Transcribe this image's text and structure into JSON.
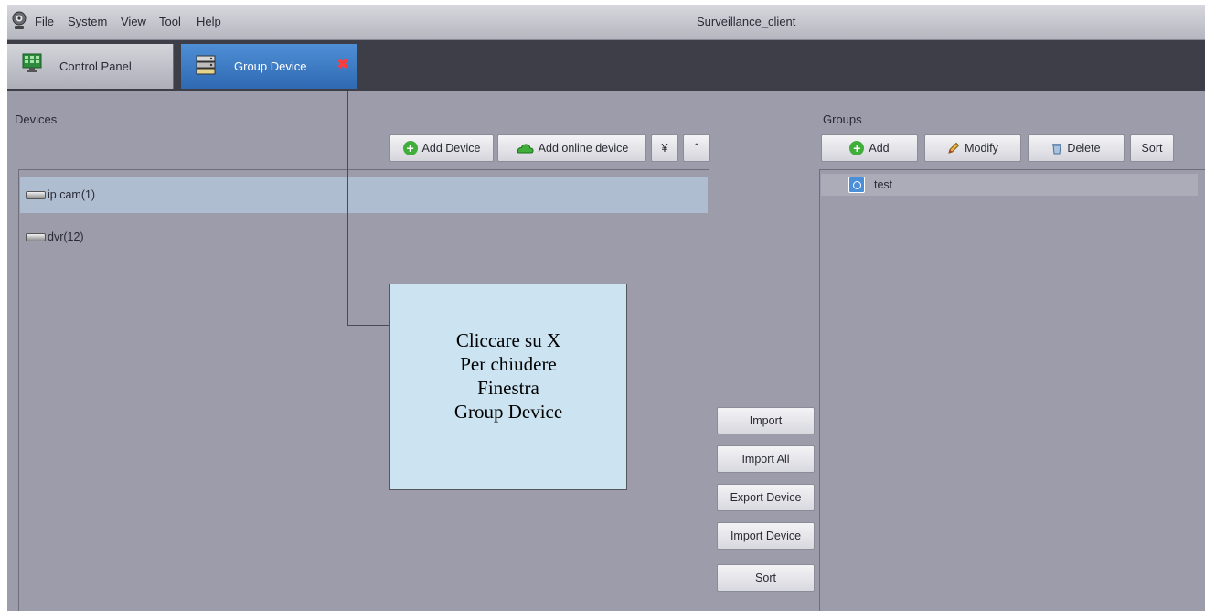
{
  "menubar": {
    "logo_icon": "webcam-icon",
    "items": [
      "File",
      "System",
      "View",
      "Tool",
      "Help"
    ],
    "window_title": "Surveillance_client"
  },
  "tabs": [
    {
      "label": "Control Panel",
      "icon": "monitor-grid-icon",
      "active": false
    },
    {
      "label": "Group Device",
      "icon": "device-stack-icon",
      "active": true,
      "close_icon": "close-icon",
      "close_symbol": "✖"
    }
  ],
  "devices": {
    "header": "Devices",
    "toolbar": {
      "add_device": "Add Device",
      "add_online_device": "Add online device",
      "expand_symbol": "¥",
      "collapse_symbol": "ˆ"
    },
    "items": [
      {
        "label": "ip cam(1)",
        "selected": true,
        "icon": "nvr-box-icon"
      },
      {
        "label": "dvr(12)",
        "selected": false,
        "icon": "nvr-box-icon"
      }
    ]
  },
  "middle": {
    "buttons": [
      "Import",
      "Import All",
      "Export Device",
      "Import Device",
      "Sort"
    ]
  },
  "groups": {
    "header": "Groups",
    "toolbar": {
      "add": "Add",
      "modify": "Modify",
      "delete": "Delete",
      "sort": "Sort"
    },
    "items": [
      {
        "label": "test",
        "icon": "group-folder-icon"
      }
    ]
  },
  "annotation": {
    "text": "Cliccare su X\nPer chiudere\nFinestra\nGroup Device"
  },
  "colors": {
    "background": "#9c9caa",
    "tab_active": "#3a7bc8",
    "tab_bar": "#3e3e48",
    "selected_row": "#aebdd0",
    "callout": "#cce3f1",
    "add_icon": "#3fae3a",
    "close_x": "#ff3b3b"
  }
}
